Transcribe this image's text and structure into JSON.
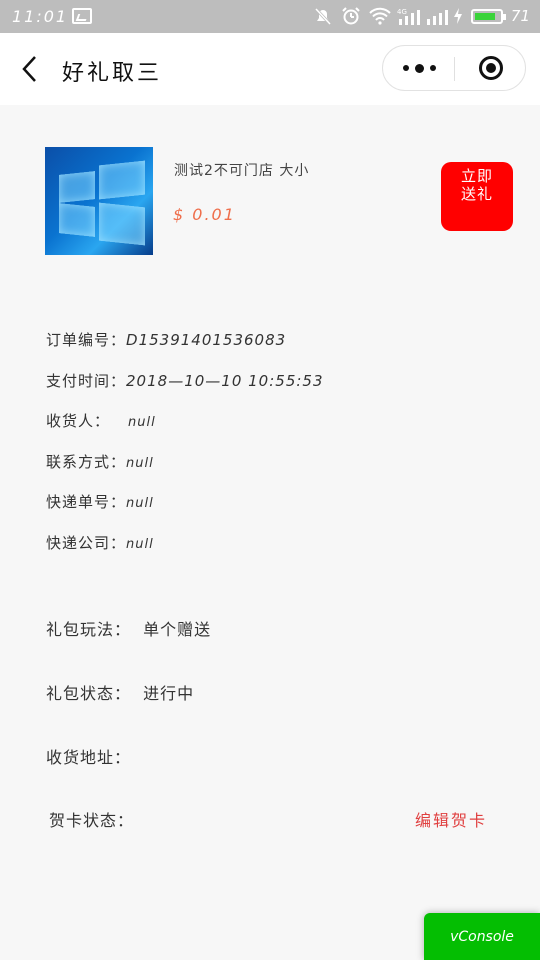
{
  "status_bar": {
    "time": "11:01",
    "battery_level": "71",
    "battery_color": "#3ad33a"
  },
  "nav": {
    "title": "好礼取三",
    "back_icon": "chevron-left-icon",
    "more_icon": "more-dots-icon",
    "close_icon": "target-icon"
  },
  "product": {
    "name": "测试2不可门店 大小",
    "price": "$ 0.01",
    "price_color": "#ef6e4b",
    "gift_button_line1": "立即",
    "gift_button_line2": "送礼",
    "gift_button_color": "#ff0000"
  },
  "order": {
    "order_no_label": "订单编号：",
    "order_no": "D15391401536083",
    "pay_time_label": "支付时间：",
    "pay_time": "2018—10—10 10:55:53",
    "receiver_label": "收货人：",
    "receiver": "null",
    "contact_label": "联系方式：",
    "contact": "null",
    "tracking_label": "快递单号：",
    "tracking": "null",
    "courier_label": "快递公司：",
    "courier": "null"
  },
  "gift": {
    "play_label": "礼包玩法：",
    "play_value": "单个赠送",
    "status_label": "礼包状态：",
    "status_value": "进行中",
    "address_label": "收货地址：",
    "card_label": "贺卡状态：",
    "card_action": "编辑贺卡",
    "card_action_color": "#e04040"
  },
  "vconsole": {
    "label": "vConsole",
    "color": "#04be02"
  }
}
